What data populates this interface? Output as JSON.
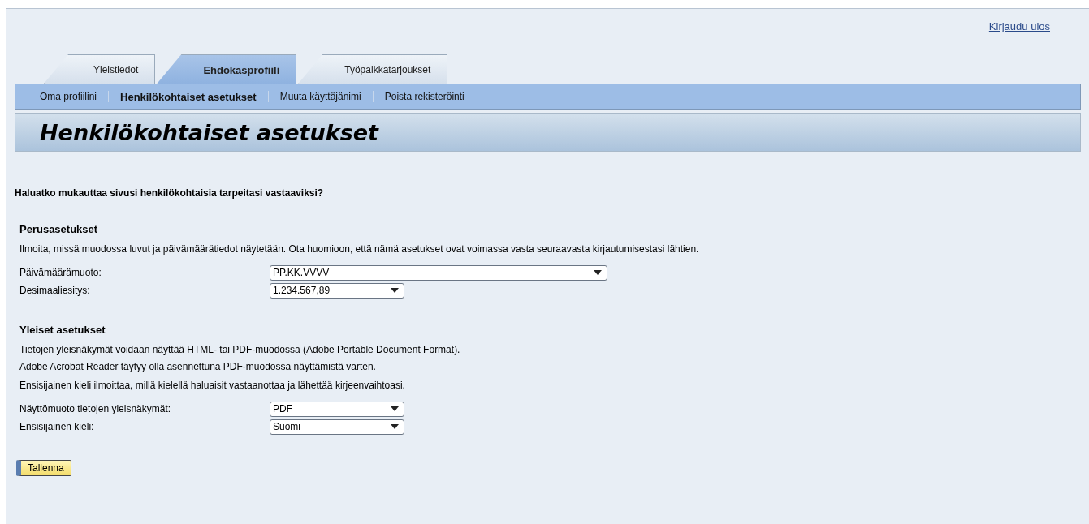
{
  "logout_link": "Kirjaudu ulos",
  "tabs": [
    {
      "label": "Yleistiedot",
      "selected": false
    },
    {
      "label": "Ehdokasprofiili",
      "selected": true
    },
    {
      "label": "Työpaikkatarjoukset",
      "selected": false
    }
  ],
  "subnav": [
    {
      "label": "Oma profiilini",
      "selected": false
    },
    {
      "label": "Henkilökohtaiset asetukset",
      "selected": true
    },
    {
      "label": "Muuta käyttäjänimi",
      "selected": false
    },
    {
      "label": "Poista rekisteröinti",
      "selected": false
    }
  ],
  "page_title": "Henkilökohtaiset asetukset",
  "intro": "Haluatko mukauttaa sivusi henkilökohtaisia tarpeitasi vastaaviksi?",
  "sections": [
    {
      "heading": "Perusasetukset",
      "paragraphs": [
        [
          "Ilmoita, missä muodossa luvut ja päivämäärätiedot näytetään. Ota huomioon, että nämä asetukset ovat voimassa vasta seuraavasta kirjautumisestasi lähtien."
        ]
      ],
      "fields": [
        {
          "label": "Päivämäärämuoto:",
          "value": "PP.KK.VVVV"
        },
        {
          "label": "Desimaaliesitys:",
          "value": "1.234.567,89"
        }
      ]
    },
    {
      "heading": "Yleiset asetukset",
      "paragraphs": [
        [
          "Tietojen yleisnäkymät voidaan näyttää HTML- tai PDF-muodossa (Adobe Portable Document Format).",
          "Adobe Acrobat Reader täytyy olla asennettuna PDF-muodossa näyttämistä varten."
        ],
        [
          "Ensisijainen kieli ilmoittaa, millä kielellä haluaisit vastaanottaa ja lähettää kirjeenvaihtoasi."
        ]
      ],
      "fields": [
        {
          "label": "Näyttömuoto tietojen yleisnäkymät:",
          "value": "PDF"
        },
        {
          "label": "Ensisijainen kieli:",
          "value": "Suomi"
        }
      ]
    }
  ],
  "save_button": "Tallenna"
}
